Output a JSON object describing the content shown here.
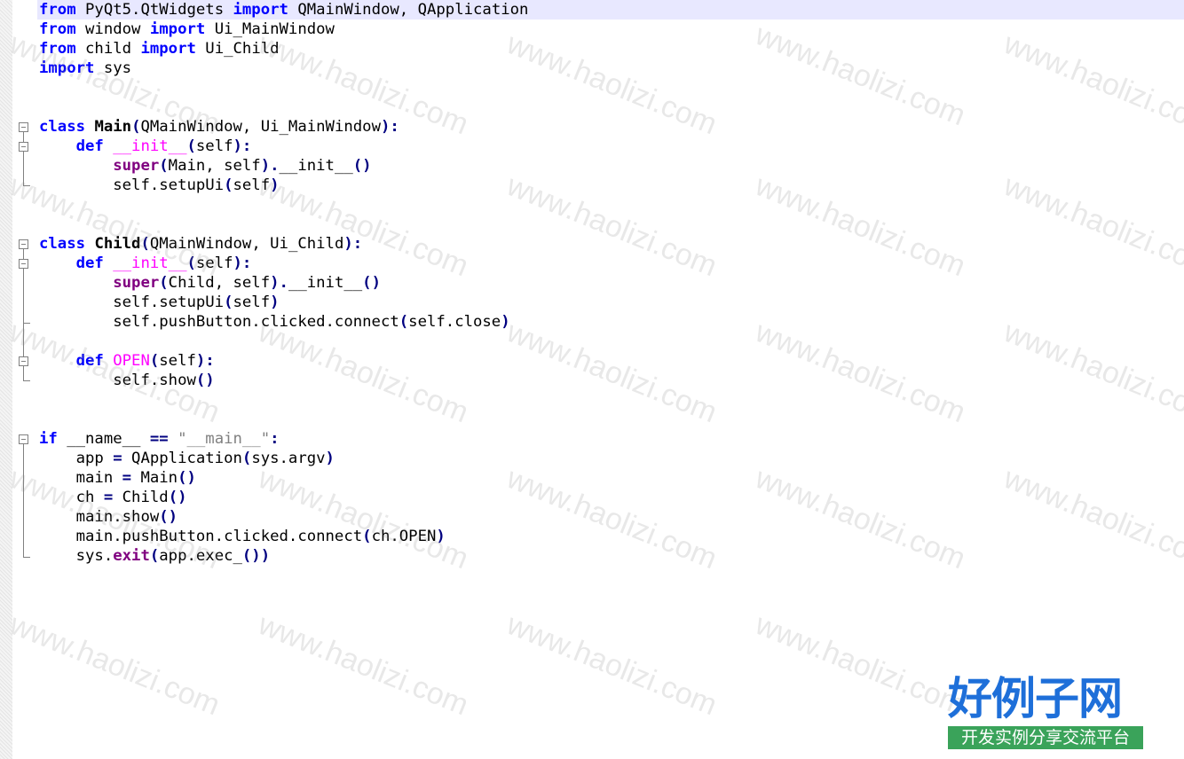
{
  "code": {
    "l1": {
      "t1": "from",
      "t2": " PyQt5.QtWidgets ",
      "t3": "import",
      "t4": " QMainWindow, QApplication"
    },
    "l2": {
      "t1": "from",
      "t2": " window ",
      "t3": "import",
      "t4": " Ui_MainWindow"
    },
    "l3": {
      "t1": "from",
      "t2": " child ",
      "t3": "import",
      "t4": " Ui_Child"
    },
    "l4": {
      "t1": "import",
      "t2": " sys"
    },
    "l7": {
      "t1": "class",
      "t2": " ",
      "t3": "Main",
      "t4": "(",
      "t5": "QMainWindow, Ui_MainWindow",
      "t6": "):"
    },
    "l8": {
      "t1": "    ",
      "t2": "def",
      "t3": " ",
      "t4": "__init__",
      "t5": "(",
      "t6": "self",
      "t7": "):"
    },
    "l9": {
      "t1": "        ",
      "t2": "super",
      "t3": "(",
      "t4": "Main, self",
      "t5": ").",
      "t6": "__init__",
      "t7": "()"
    },
    "l10": {
      "t1": "        self.setupUi",
      "t2": "(",
      "t3": "self",
      "t4": ")"
    },
    "l13": {
      "t1": "class",
      "t2": " ",
      "t3": "Child",
      "t4": "(",
      "t5": "QMainWindow, Ui_Child",
      "t6": "):"
    },
    "l14": {
      "t1": "    ",
      "t2": "def",
      "t3": " ",
      "t4": "__init__",
      "t5": "(",
      "t6": "self",
      "t7": "):"
    },
    "l15": {
      "t1": "        ",
      "t2": "super",
      "t3": "(",
      "t4": "Child, self",
      "t5": ").",
      "t6": "__init__",
      "t7": "()"
    },
    "l16": {
      "t1": "        self.setupUi",
      "t2": "(",
      "t3": "self",
      "t4": ")"
    },
    "l17": {
      "t1": "        self.pushButton.clicked.connect",
      "t2": "(",
      "t3": "self.close",
      "t4": ")"
    },
    "l19": {
      "t1": "    ",
      "t2": "def",
      "t3": " ",
      "t4": "OPEN",
      "t5": "(",
      "t6": "self",
      "t7": "):"
    },
    "l20": {
      "t1": "        self.show",
      "t2": "()"
    },
    "l23": {
      "t1": "if",
      "t2": " __name__ ",
      "t3": "==",
      "t4": " ",
      "t5": "\"__main__\"",
      "t6": ":"
    },
    "l24": {
      "t1": "    app ",
      "t2": "=",
      "t3": " QApplication",
      "t4": "(",
      "t5": "sys.argv",
      "t6": ")"
    },
    "l25": {
      "t1": "    main ",
      "t2": "=",
      "t3": " Main",
      "t4": "()"
    },
    "l26": {
      "t1": "    ch ",
      "t2": "=",
      "t3": " Child",
      "t4": "()"
    },
    "l27": {
      "t1": "    main.show",
      "t2": "()"
    },
    "l28": {
      "t1": "    main.pushButton.clicked.connect",
      "t2": "(",
      "t3": "ch.OPEN",
      "t4": ")"
    },
    "l29": {
      "t1": "    sys.",
      "t2": "exit",
      "t3": "(",
      "t4": "app.exec_",
      "t5": "())"
    }
  },
  "watermark": {
    "text": "www.haolizi.com"
  },
  "logo": {
    "main": "好例子网",
    "sub": "开发实例分享交流平台"
  },
  "colors": {
    "keyword": "#0000ff",
    "operator": "#000080",
    "magic": "#ff00ff",
    "builtin": "#800080",
    "string": "#808080",
    "current_line": "#e8e8ff",
    "logo_blue": "#1e6fd9",
    "logo_green": "#3aa35a"
  }
}
